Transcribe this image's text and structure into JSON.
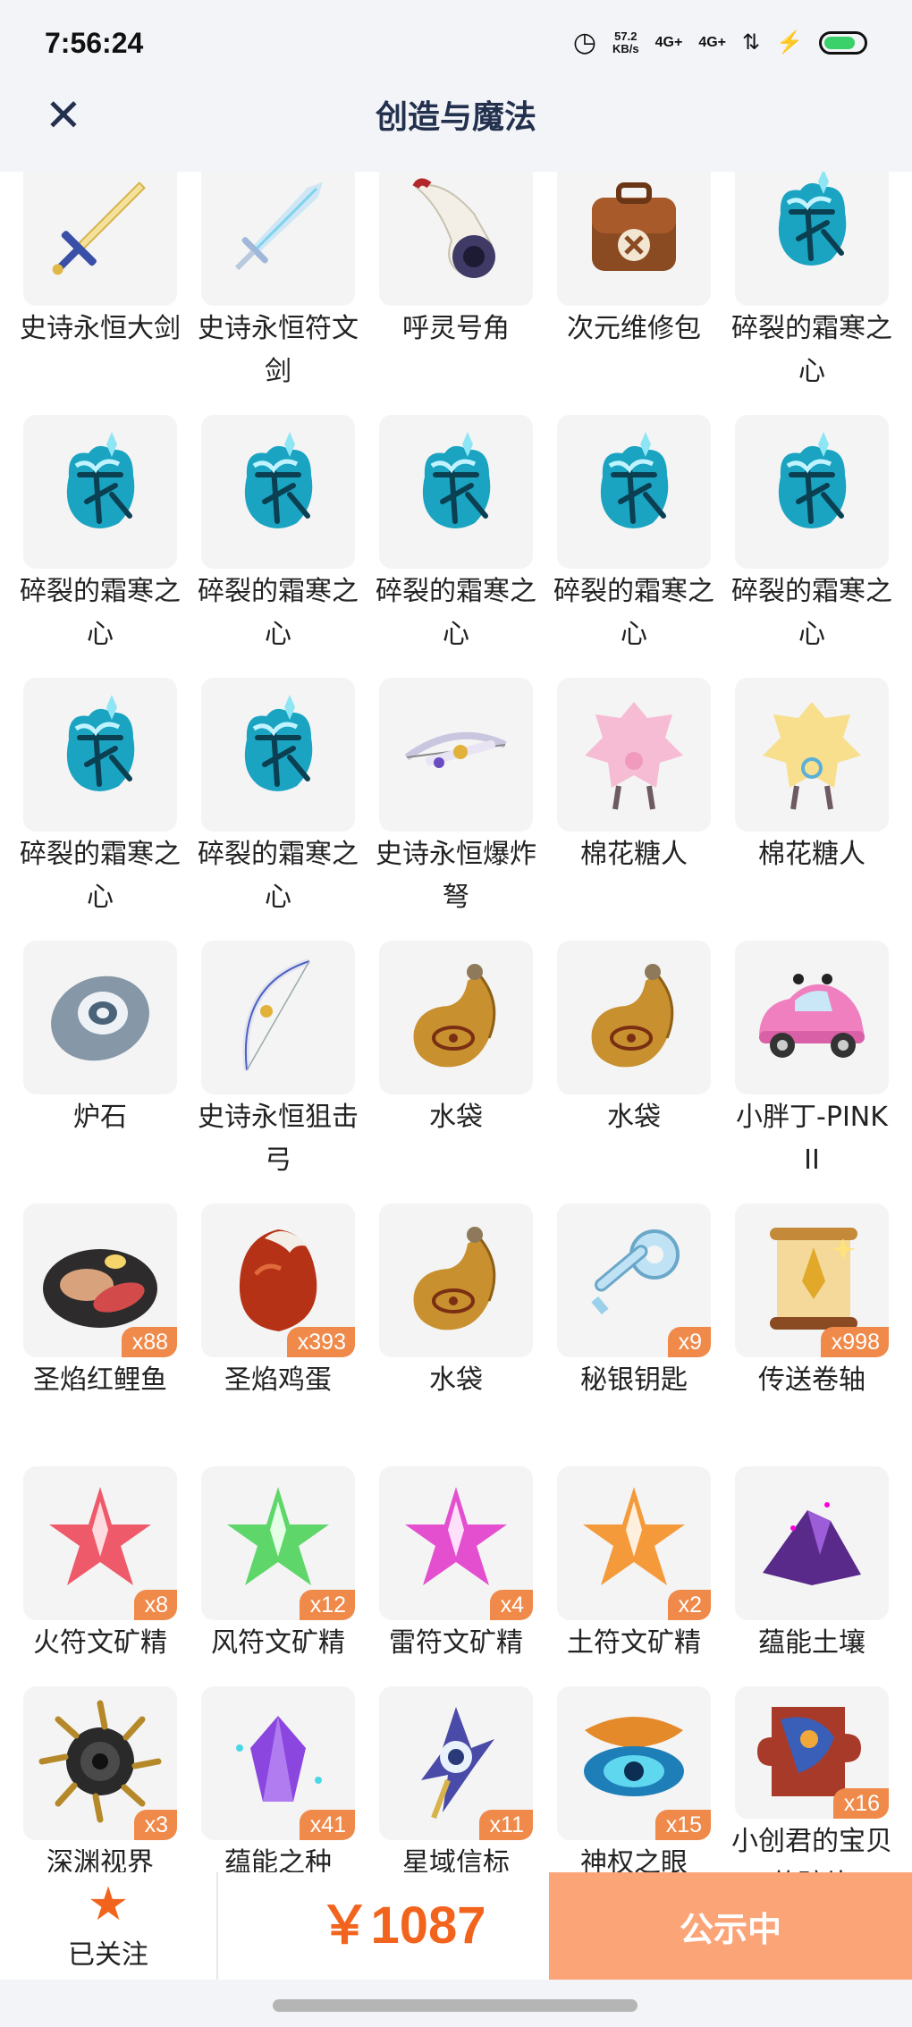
{
  "status_bar": {
    "time": "7:56:24",
    "speed_value": "57.2",
    "speed_unit": "KB/s",
    "signal1": "4G+",
    "signal2": "4G+"
  },
  "header": {
    "title": "创造与魔法",
    "close_icon": "close-icon"
  },
  "items": [
    {
      "name": "史诗永恒大剑",
      "icon": "greatsword",
      "count": ""
    },
    {
      "name": "史诗永恒符文剑",
      "icon": "rune-sword",
      "count": ""
    },
    {
      "name": "呼灵号角",
      "icon": "horn",
      "count": ""
    },
    {
      "name": "次元维修包",
      "icon": "repair-bag",
      "count": ""
    },
    {
      "name": "碎裂的霜寒之心",
      "icon": "frost-heart",
      "count": ""
    },
    {
      "name": "碎裂的霜寒之心",
      "icon": "frost-heart",
      "count": ""
    },
    {
      "name": "碎裂的霜寒之心",
      "icon": "frost-heart",
      "count": ""
    },
    {
      "name": "碎裂的霜寒之心",
      "icon": "frost-heart",
      "count": ""
    },
    {
      "name": "碎裂的霜寒之心",
      "icon": "frost-heart",
      "count": ""
    },
    {
      "name": "碎裂的霜寒之心",
      "icon": "frost-heart",
      "count": ""
    },
    {
      "name": "碎裂的霜寒之心",
      "icon": "frost-heart",
      "count": ""
    },
    {
      "name": "碎裂的霜寒之心",
      "icon": "frost-heart",
      "count": ""
    },
    {
      "name": "史诗永恒爆炸弩",
      "icon": "crossbow",
      "count": ""
    },
    {
      "name": "棉花糖人",
      "icon": "cotton-pink",
      "count": ""
    },
    {
      "name": "棉花糖人",
      "icon": "cotton-yellow",
      "count": ""
    },
    {
      "name": "炉石",
      "icon": "hearthstone",
      "count": ""
    },
    {
      "name": "史诗永恒狙击弓",
      "icon": "bow",
      "count": ""
    },
    {
      "name": "水袋",
      "icon": "water-bag",
      "count": ""
    },
    {
      "name": "水袋",
      "icon": "water-bag",
      "count": ""
    },
    {
      "name": "小胖丁-PINK II",
      "icon": "pink-car",
      "count": ""
    },
    {
      "name": "圣焰红鲤鱼",
      "icon": "fish-plate",
      "count": "x88"
    },
    {
      "name": "圣焰鸡蛋",
      "icon": "egg",
      "count": "x393"
    },
    {
      "name": "水袋",
      "icon": "water-bag",
      "count": ""
    },
    {
      "name": "秘银钥匙",
      "icon": "key",
      "count": "x9"
    },
    {
      "name": "传送卷轴",
      "icon": "scroll",
      "count": "x998"
    },
    {
      "name": "火符文矿精",
      "icon": "crystal-red",
      "count": "x8"
    },
    {
      "name": "风符文矿精",
      "icon": "crystal-green",
      "count": "x12"
    },
    {
      "name": "雷符文矿精",
      "icon": "crystal-magenta",
      "count": "x4"
    },
    {
      "name": "土符文矿精",
      "icon": "crystal-orange",
      "count": "x2"
    },
    {
      "name": "蕴能土壤",
      "icon": "soil",
      "count": ""
    },
    {
      "name": "深渊视界",
      "icon": "abyss-sun",
      "count": "x3"
    },
    {
      "name": "蕴能之种",
      "icon": "seed-crystal",
      "count": "x41"
    },
    {
      "name": "星域信标",
      "icon": "beacon",
      "count": "x11"
    },
    {
      "name": "神权之眼",
      "icon": "eye",
      "count": "x15"
    },
    {
      "name": "小创君的宝贝的碎片",
      "icon": "puzzle",
      "count": "x16"
    }
  ],
  "bottom_bar": {
    "follow_label": "已关注",
    "star_icon": "star-icon",
    "price": "￥1087",
    "status_button": "公示中"
  },
  "colors": {
    "accent": "#f2641e",
    "badge": "#f08a4a",
    "button": "#fba478",
    "header_bg": "#f2f4f8"
  }
}
